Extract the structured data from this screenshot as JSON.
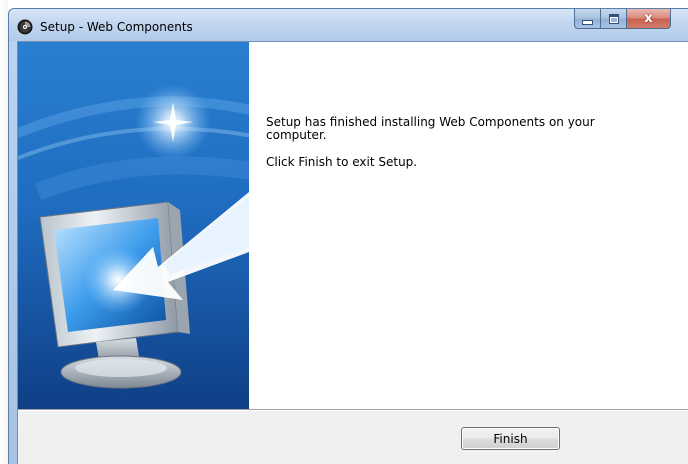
{
  "window": {
    "title": "Setup - Web Components",
    "close_glyph": "x"
  },
  "content": {
    "finish_message": "Setup has finished installing Web Components on your computer.",
    "exit_message": "Click Finish to exit Setup."
  },
  "buttons": {
    "finish_label": "Finish"
  },
  "icons": {
    "app": "setup-disc-icon",
    "minimize": "minimize-icon",
    "maximize": "maximize-icon",
    "close": "close-icon",
    "wizard_art": "monitor-arrow-illustration"
  },
  "colors": {
    "wizard_blue": "#1f6fc3",
    "frame_blue": "#b2cbe9",
    "close_red": "#c8614f",
    "button_bar": "#f0f0f0"
  }
}
